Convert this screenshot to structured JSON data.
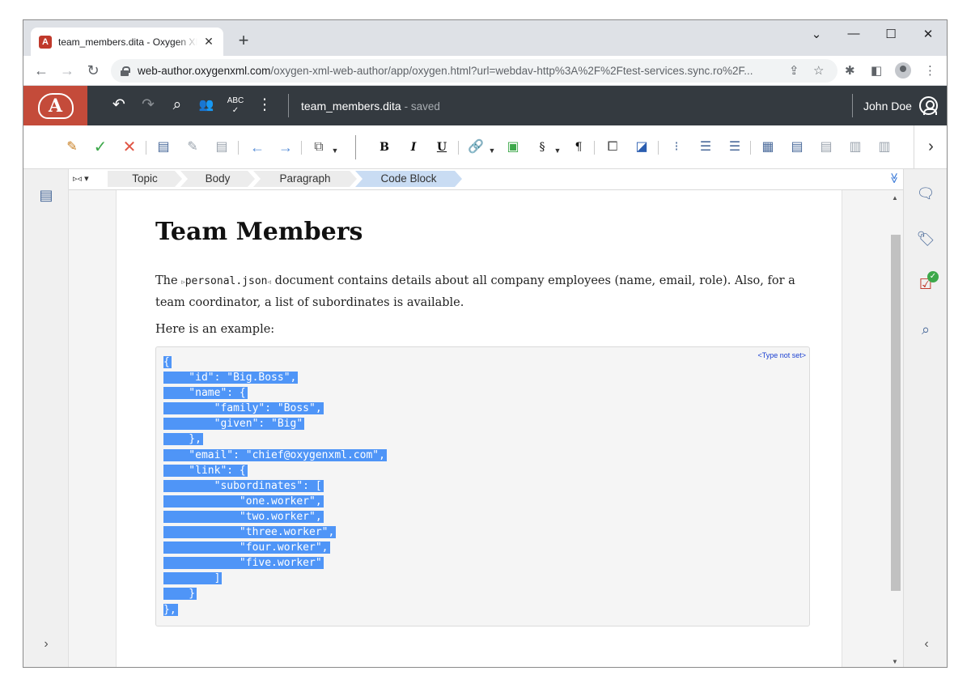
{
  "browser": {
    "tab_title": "team_members.dita - Oxygen XML Web Author",
    "tab_favicon": "A",
    "tab_close": "✕",
    "new_tab": "+",
    "win_minimize": "—",
    "win_maximize": "☐",
    "win_close": "✕",
    "win_menu": "⌄",
    "url_host": "web-author.oxygenxml.com",
    "url_path": "/oxygen-xml-web-author/app/oxygen.html?url=webdav-http%3A%2F%2Ftest-services.sync.ro%2F..."
  },
  "app": {
    "logo_letter": "A",
    "doc_name": "team_members.dita",
    "doc_status": "- saved",
    "user_name": "John Doe"
  },
  "toolbar": {
    "bold": "B",
    "italic": "I",
    "underline": "U",
    "section": "§",
    "pilcrow": "¶"
  },
  "breadcrumb": [
    "Topic",
    "Body",
    "Paragraph",
    "Code Block"
  ],
  "document": {
    "title": "Team Members",
    "para1_before": "The ",
    "codeph": "personal.json",
    "para1_after": " document contains details about all company employees (name, email, role). Also, for a team coordinator, a list of subordinates is available.",
    "para2": "Here is an example:",
    "codeblock_type": "<Type not set>",
    "code_lines": [
      "{",
      "    \"id\": \"Big.Boss\",",
      "    \"name\": {",
      "        \"family\": \"Boss\",",
      "        \"given\": \"Big\"",
      "    },",
      "    \"email\": \"chief@oxygenxml.com\",",
      "    \"link\": {",
      "        \"subordinates\": [",
      "            \"one.worker\",",
      "            \"two.worker\",",
      "            \"three.worker\",",
      "            \"four.worker\",",
      "            \"five.worker\"",
      "        ]",
      "    }",
      "},"
    ]
  }
}
